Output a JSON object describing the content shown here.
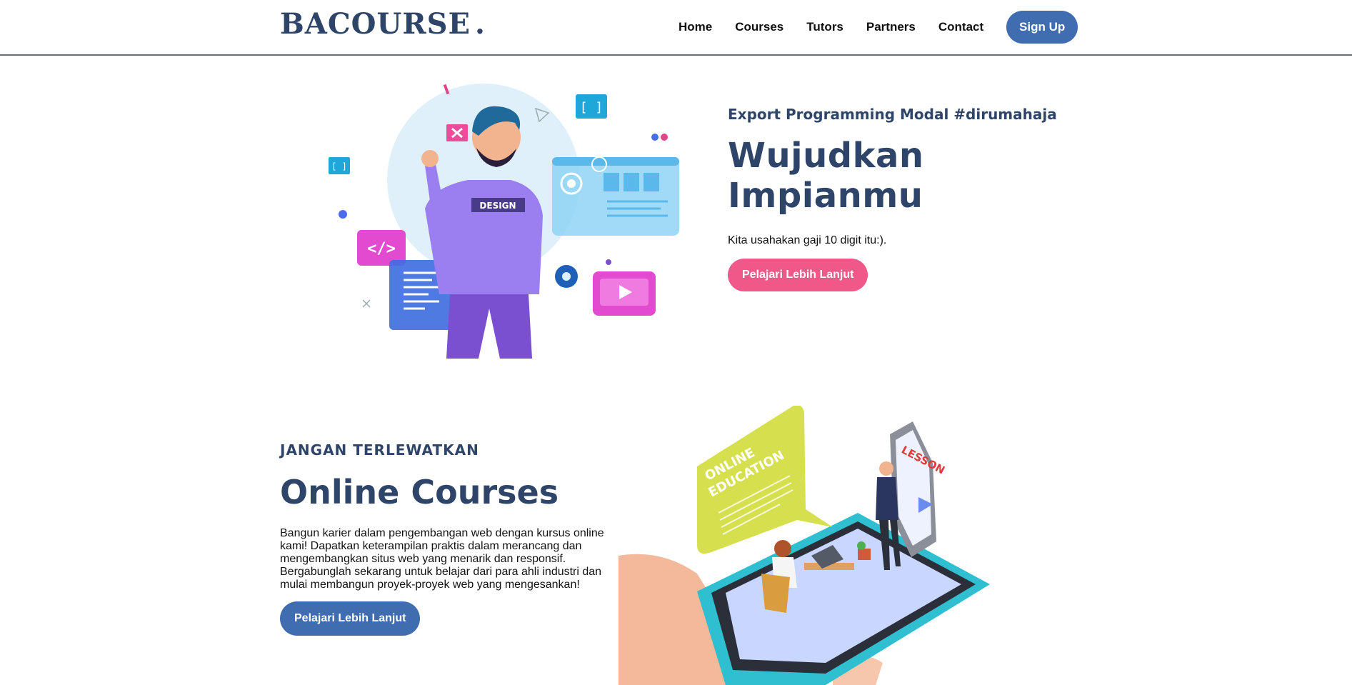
{
  "header": {
    "brand": "BACOURSE",
    "brand_dot": ".",
    "nav": [
      "Home",
      "Courses",
      "Tutors",
      "Partners",
      "Contact"
    ],
    "signup_label": "Sign Up"
  },
  "hero": {
    "eyebrow": "Export Programming Modal #dirumahaja",
    "title": "Wujudkan Impianmu",
    "description": "Kita usahakan gaji 10 digit itu:).",
    "cta_label": "Pelajari Lebih Lanjut",
    "illustration": {
      "shirt_text": "DESIGN"
    }
  },
  "section2": {
    "eyebrow": "JANGAN TERLEWATKAN",
    "title": "Online Courses",
    "description": "Bangun karier dalam pengembangan web dengan kursus online kami! Dapatkan keterampilan praktis dalam merancang dan mengembangkan situs web yang menarik dan responsif. Bergabunglah sekarang untuk belajar dari para ahli industri dan mulai membangun proyek-proyek web yang mengesankan!",
    "cta_label": "Pelajari Lebih Lanjut",
    "illustration": {
      "bubble_line1": "ONLINE",
      "bubble_line2": "EDUCATION",
      "screen_text": "LESSON"
    }
  },
  "colors": {
    "navy": "#2e4468",
    "blue_button": "#3f6db0",
    "pink_button": "#f0588a"
  }
}
